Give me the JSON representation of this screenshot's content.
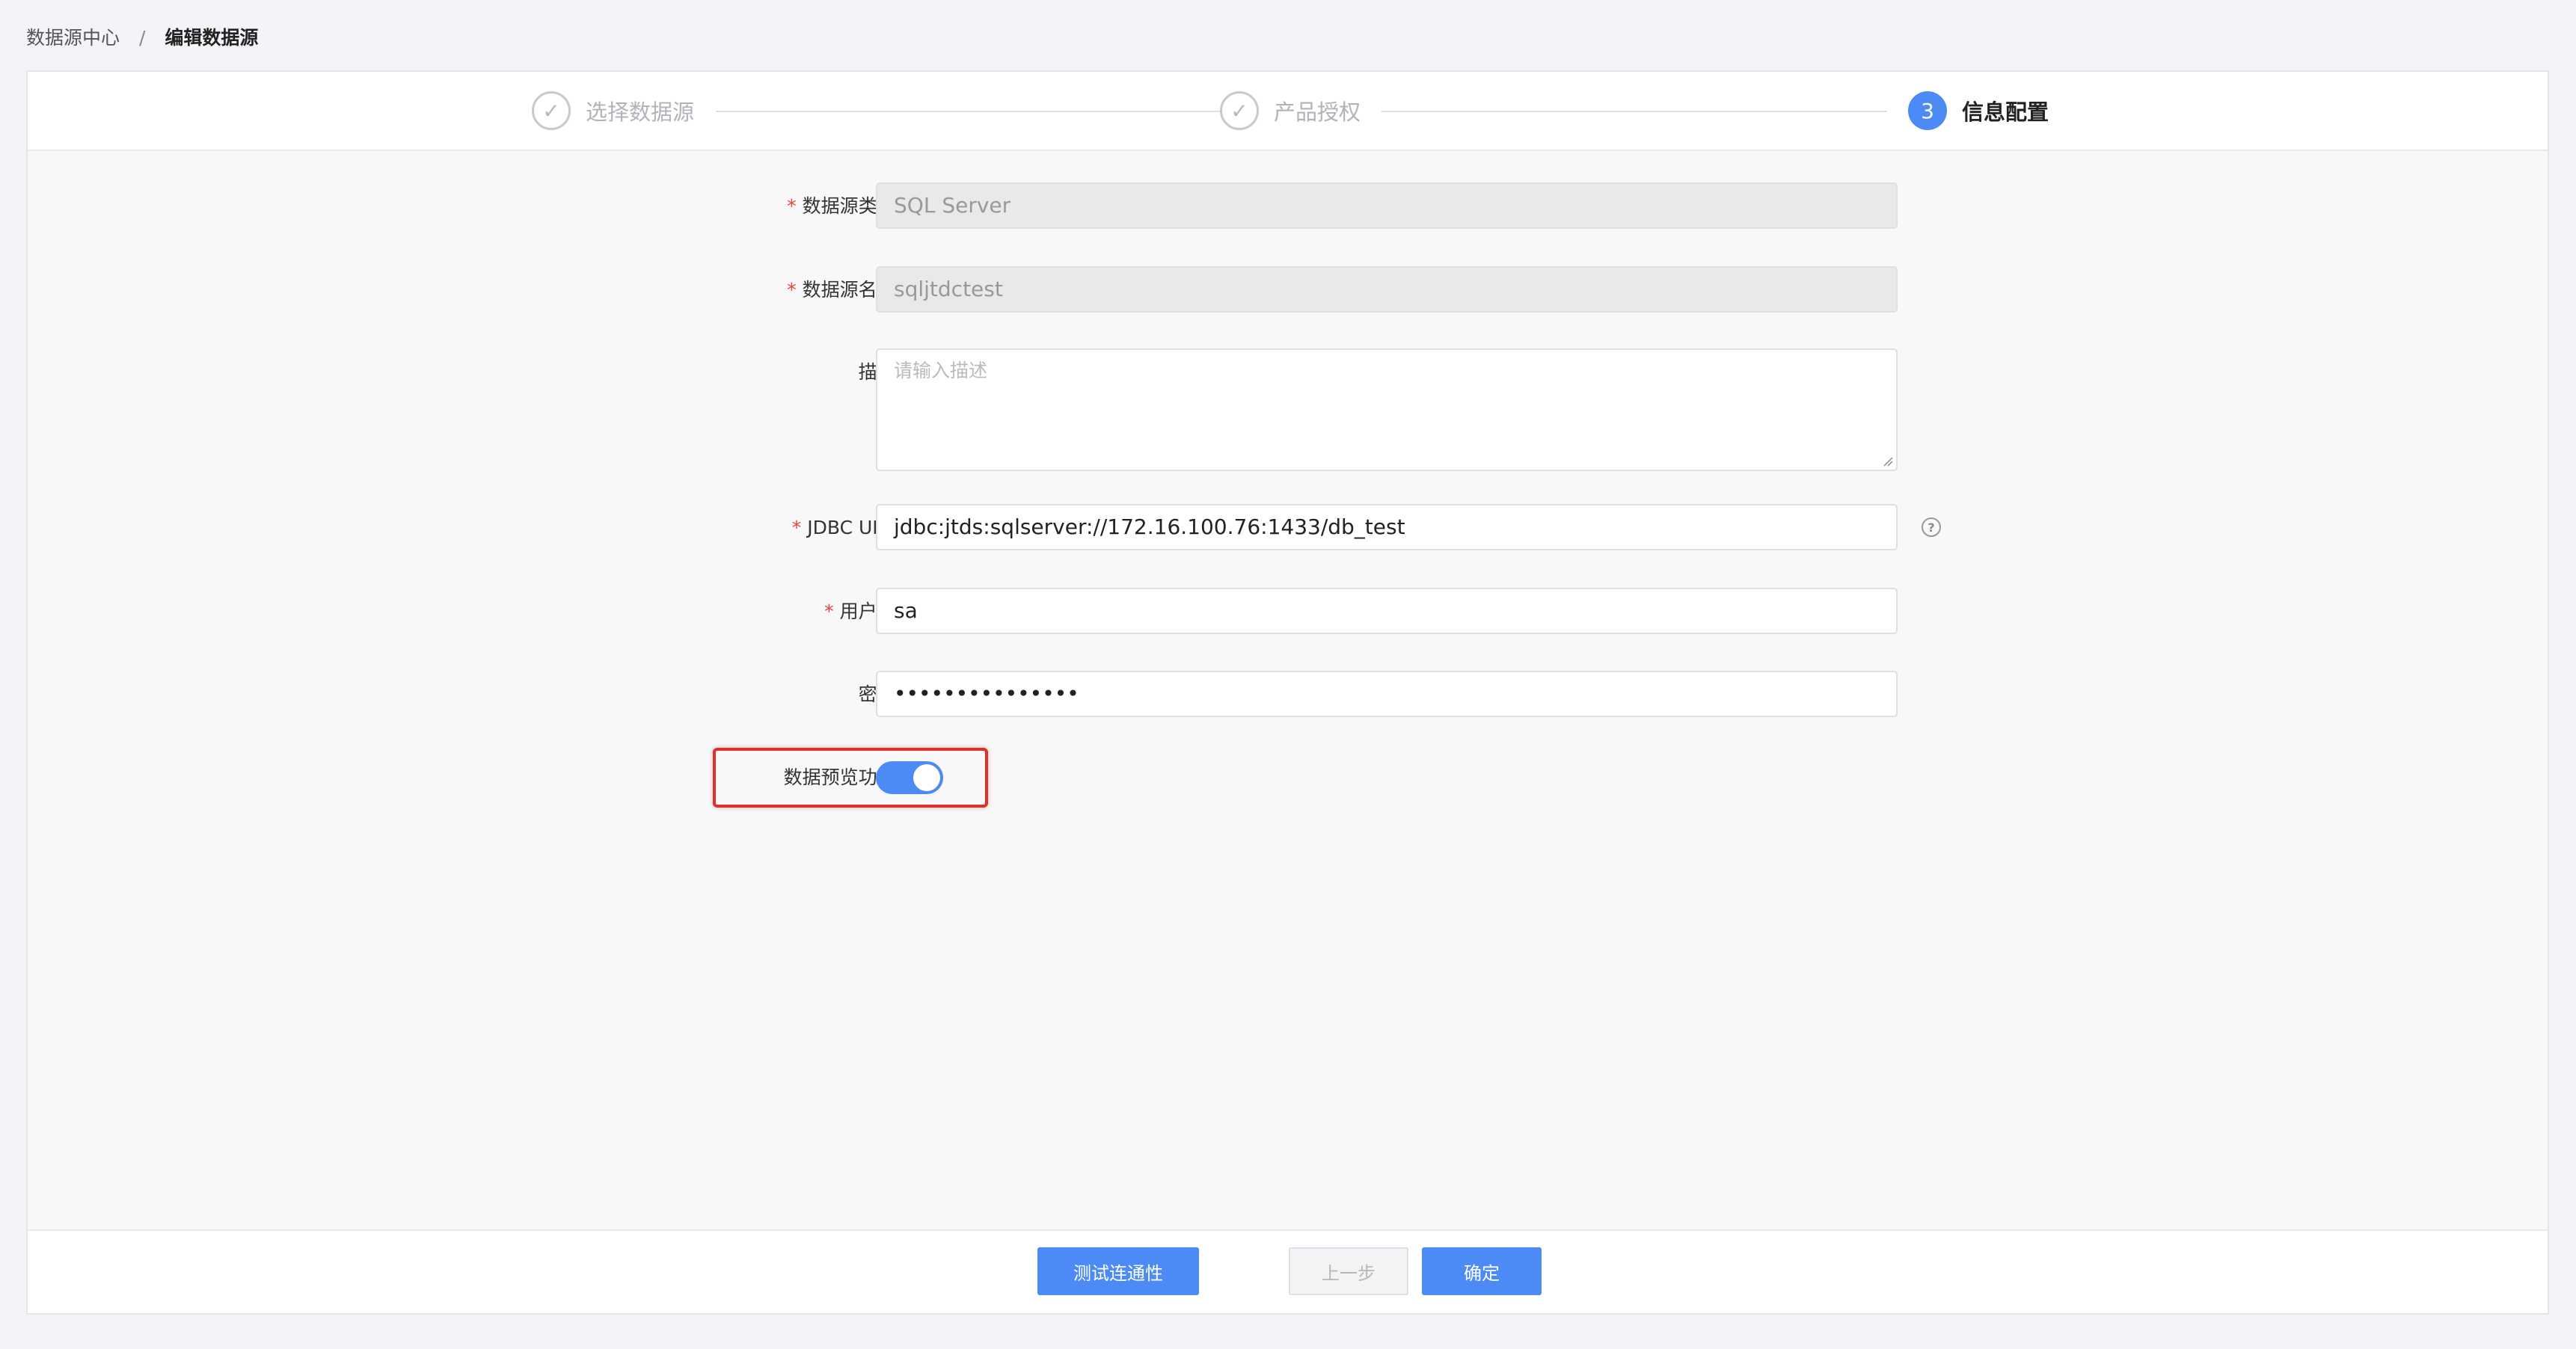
{
  "breadcrumb": {
    "root": "数据源中心",
    "separator": "/",
    "current": "编辑数据源"
  },
  "steps": [
    {
      "label": "选择数据源",
      "status": "done",
      "marker": "✓"
    },
    {
      "label": "产品授权",
      "status": "done",
      "marker": "✓"
    },
    {
      "label": "信息配置",
      "status": "active",
      "marker": "3"
    }
  ],
  "form": {
    "type": {
      "label": "数据源类型:",
      "value": "SQL Server"
    },
    "name": {
      "label": "数据源名称:",
      "value": "sqljtdctest"
    },
    "desc": {
      "label": "描述:",
      "placeholder": "请输入描述"
    },
    "jdbc": {
      "label": "JDBC URL:",
      "value": "jdbc:jtds:sqlserver://172.16.100.76:1433/db_test",
      "help": "?"
    },
    "user": {
      "label": "用户名:",
      "value": "sa"
    },
    "password": {
      "label": "密码:",
      "value": "•••••••••••••••"
    },
    "preview": {
      "label": "数据预览功能:",
      "enabled": true
    }
  },
  "footer": {
    "test": "测试连通性",
    "prev": "上一步",
    "confirm": "确定"
  },
  "colors": {
    "primary": "#4c8bf5",
    "required": "#e5453a",
    "highlight": "#d9332b"
  }
}
